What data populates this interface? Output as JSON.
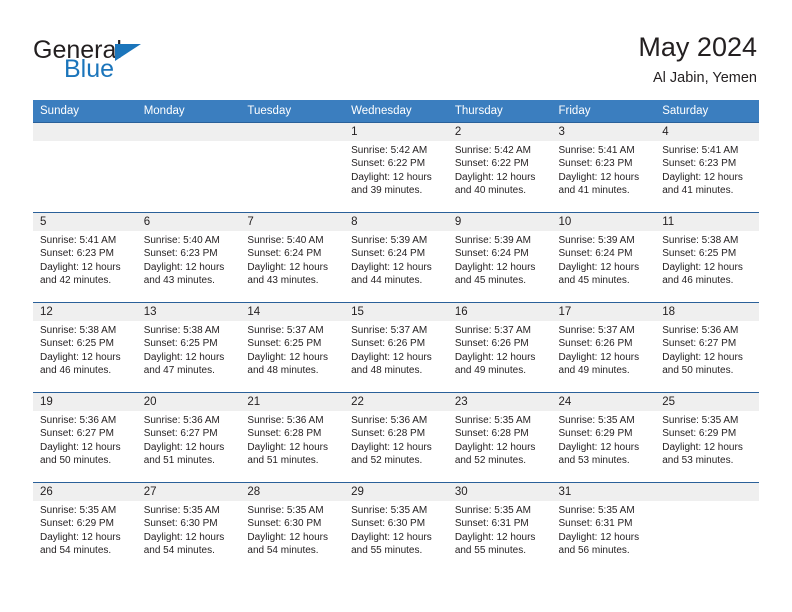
{
  "brand": {
    "name_part1": "General",
    "name_part2": "Blue",
    "accent_color": "#1b75bb",
    "triangle_icon": "triangle-icon"
  },
  "header": {
    "title": "May 2024",
    "subtitle": "Al Jabin, Yemen"
  },
  "colors": {
    "header_row_bg": "#3b7ebf",
    "header_row_text": "#ffffff",
    "daynum_bg": "#efefef",
    "grid_line": "#2a6099",
    "body_text": "#231f20"
  },
  "weekday_headers": [
    "Sunday",
    "Monday",
    "Tuesday",
    "Wednesday",
    "Thursday",
    "Friday",
    "Saturday"
  ],
  "weeks": [
    [
      {
        "day": "",
        "lines": []
      },
      {
        "day": "",
        "lines": []
      },
      {
        "day": "",
        "lines": []
      },
      {
        "day": "1",
        "lines": [
          "Sunrise: 5:42 AM",
          "Sunset: 6:22 PM",
          "Daylight: 12 hours",
          "and 39 minutes."
        ]
      },
      {
        "day": "2",
        "lines": [
          "Sunrise: 5:42 AM",
          "Sunset: 6:22 PM",
          "Daylight: 12 hours",
          "and 40 minutes."
        ]
      },
      {
        "day": "3",
        "lines": [
          "Sunrise: 5:41 AM",
          "Sunset: 6:23 PM",
          "Daylight: 12 hours",
          "and 41 minutes."
        ]
      },
      {
        "day": "4",
        "lines": [
          "Sunrise: 5:41 AM",
          "Sunset: 6:23 PM",
          "Daylight: 12 hours",
          "and 41 minutes."
        ]
      }
    ],
    [
      {
        "day": "5",
        "lines": [
          "Sunrise: 5:41 AM",
          "Sunset: 6:23 PM",
          "Daylight: 12 hours",
          "and 42 minutes."
        ]
      },
      {
        "day": "6",
        "lines": [
          "Sunrise: 5:40 AM",
          "Sunset: 6:23 PM",
          "Daylight: 12 hours",
          "and 43 minutes."
        ]
      },
      {
        "day": "7",
        "lines": [
          "Sunrise: 5:40 AM",
          "Sunset: 6:24 PM",
          "Daylight: 12 hours",
          "and 43 minutes."
        ]
      },
      {
        "day": "8",
        "lines": [
          "Sunrise: 5:39 AM",
          "Sunset: 6:24 PM",
          "Daylight: 12 hours",
          "and 44 minutes."
        ]
      },
      {
        "day": "9",
        "lines": [
          "Sunrise: 5:39 AM",
          "Sunset: 6:24 PM",
          "Daylight: 12 hours",
          "and 45 minutes."
        ]
      },
      {
        "day": "10",
        "lines": [
          "Sunrise: 5:39 AM",
          "Sunset: 6:24 PM",
          "Daylight: 12 hours",
          "and 45 minutes."
        ]
      },
      {
        "day": "11",
        "lines": [
          "Sunrise: 5:38 AM",
          "Sunset: 6:25 PM",
          "Daylight: 12 hours",
          "and 46 minutes."
        ]
      }
    ],
    [
      {
        "day": "12",
        "lines": [
          "Sunrise: 5:38 AM",
          "Sunset: 6:25 PM",
          "Daylight: 12 hours",
          "and 46 minutes."
        ]
      },
      {
        "day": "13",
        "lines": [
          "Sunrise: 5:38 AM",
          "Sunset: 6:25 PM",
          "Daylight: 12 hours",
          "and 47 minutes."
        ]
      },
      {
        "day": "14",
        "lines": [
          "Sunrise: 5:37 AM",
          "Sunset: 6:25 PM",
          "Daylight: 12 hours",
          "and 48 minutes."
        ]
      },
      {
        "day": "15",
        "lines": [
          "Sunrise: 5:37 AM",
          "Sunset: 6:26 PM",
          "Daylight: 12 hours",
          "and 48 minutes."
        ]
      },
      {
        "day": "16",
        "lines": [
          "Sunrise: 5:37 AM",
          "Sunset: 6:26 PM",
          "Daylight: 12 hours",
          "and 49 minutes."
        ]
      },
      {
        "day": "17",
        "lines": [
          "Sunrise: 5:37 AM",
          "Sunset: 6:26 PM",
          "Daylight: 12 hours",
          "and 49 minutes."
        ]
      },
      {
        "day": "18",
        "lines": [
          "Sunrise: 5:36 AM",
          "Sunset: 6:27 PM",
          "Daylight: 12 hours",
          "and 50 minutes."
        ]
      }
    ],
    [
      {
        "day": "19",
        "lines": [
          "Sunrise: 5:36 AM",
          "Sunset: 6:27 PM",
          "Daylight: 12 hours",
          "and 50 minutes."
        ]
      },
      {
        "day": "20",
        "lines": [
          "Sunrise: 5:36 AM",
          "Sunset: 6:27 PM",
          "Daylight: 12 hours",
          "and 51 minutes."
        ]
      },
      {
        "day": "21",
        "lines": [
          "Sunrise: 5:36 AM",
          "Sunset: 6:28 PM",
          "Daylight: 12 hours",
          "and 51 minutes."
        ]
      },
      {
        "day": "22",
        "lines": [
          "Sunrise: 5:36 AM",
          "Sunset: 6:28 PM",
          "Daylight: 12 hours",
          "and 52 minutes."
        ]
      },
      {
        "day": "23",
        "lines": [
          "Sunrise: 5:35 AM",
          "Sunset: 6:28 PM",
          "Daylight: 12 hours",
          "and 52 minutes."
        ]
      },
      {
        "day": "24",
        "lines": [
          "Sunrise: 5:35 AM",
          "Sunset: 6:29 PM",
          "Daylight: 12 hours",
          "and 53 minutes."
        ]
      },
      {
        "day": "25",
        "lines": [
          "Sunrise: 5:35 AM",
          "Sunset: 6:29 PM",
          "Daylight: 12 hours",
          "and 53 minutes."
        ]
      }
    ],
    [
      {
        "day": "26",
        "lines": [
          "Sunrise: 5:35 AM",
          "Sunset: 6:29 PM",
          "Daylight: 12 hours",
          "and 54 minutes."
        ]
      },
      {
        "day": "27",
        "lines": [
          "Sunrise: 5:35 AM",
          "Sunset: 6:30 PM",
          "Daylight: 12 hours",
          "and 54 minutes."
        ]
      },
      {
        "day": "28",
        "lines": [
          "Sunrise: 5:35 AM",
          "Sunset: 6:30 PM",
          "Daylight: 12 hours",
          "and 54 minutes."
        ]
      },
      {
        "day": "29",
        "lines": [
          "Sunrise: 5:35 AM",
          "Sunset: 6:30 PM",
          "Daylight: 12 hours",
          "and 55 minutes."
        ]
      },
      {
        "day": "30",
        "lines": [
          "Sunrise: 5:35 AM",
          "Sunset: 6:31 PM",
          "Daylight: 12 hours",
          "and 55 minutes."
        ]
      },
      {
        "day": "31",
        "lines": [
          "Sunrise: 5:35 AM",
          "Sunset: 6:31 PM",
          "Daylight: 12 hours",
          "and 56 minutes."
        ]
      },
      {
        "day": "",
        "lines": []
      }
    ]
  ]
}
